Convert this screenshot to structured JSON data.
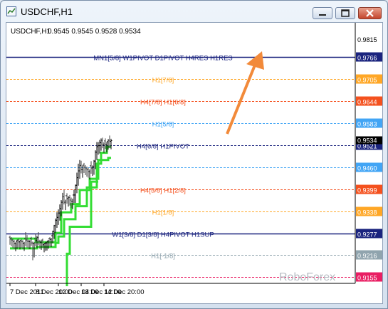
{
  "window": {
    "title": "USDCHF,H1"
  },
  "chart_header": {
    "symbol": "USDCHF,H1",
    "ohlc": "0.9545 0.9545 0.9528 0.9534"
  },
  "watermark": "RoboForex",
  "chart_data": {
    "type": "line",
    "title": "USDCHF,H1",
    "ylim": [
      0.913,
      0.9845
    ],
    "y_ticks": [
      "0.9815",
      "0.9155"
    ],
    "x_tick_labels": [
      "7 Dec 2011",
      "8 Dec 20:00",
      "12 Dec 04:00",
      "13 Dec 12:00",
      "14 Dec 20:00"
    ],
    "x_ticks": [
      {
        "label": "7 Dec 2011",
        "x": 0
      },
      {
        "label": "8 Dec 20:00",
        "x": 36
      },
      {
        "label": "12 Dec 04:00",
        "x": 68
      },
      {
        "label": "13 Dec 12:00",
        "x": 100
      },
      {
        "label": "14 Dec 20:00",
        "x": 132
      }
    ],
    "levels": [
      {
        "label": "MN1[5/8] W1PIVOT D1PIVOT H4RES H1RES",
        "value": 0.9766,
        "value_label": "0.9766",
        "color": "#1a237e",
        "style": "solid"
      },
      {
        "label": "H1[7/8]",
        "value": 0.9705,
        "value_label": "0.9705",
        "color": "#ffa726",
        "style": "dashed"
      },
      {
        "label": "H4[7/8] H1[6/8]",
        "value": 0.9644,
        "value_label": "0.9644",
        "color": "#f4511e",
        "style": "dashed"
      },
      {
        "label": "H1[5/8]",
        "value": 0.9583,
        "value_label": "0.9583",
        "color": "#42a5f5",
        "style": "dashed"
      },
      {
        "label": "H4[6/8] H1PIVOT",
        "value": 0.9521,
        "value_label": "0.9521",
        "color": "#1a237e",
        "style": "dashed"
      },
      {
        "label": "",
        "value": 0.946,
        "value_label": "0.9460",
        "color": "#42a5f5",
        "style": "dashed"
      },
      {
        "label": "H4[5/8] H1[2/8]",
        "value": 0.9399,
        "value_label": "0.9399",
        "color": "#f4511e",
        "style": "dashed"
      },
      {
        "label": "H1[1/8]",
        "value": 0.9338,
        "value_label": "0.9338",
        "color": "#ffa726",
        "style": "dashed"
      },
      {
        "label": "W1[3/8] D1[3/8] H4PIVOT H1SUP",
        "value": 0.9277,
        "value_label": "0.9277",
        "color": "#1a237e",
        "style": "solid"
      },
      {
        "label": "H1[-1/8]",
        "value": 0.9216,
        "value_label": "0.9216",
        "color": "#90a4ae",
        "style": "dashed"
      },
      {
        "label": "",
        "value": 0.9155,
        "value_label": "0.9155",
        "color": "#e91e63",
        "style": "dashed"
      }
    ],
    "current_price": {
      "value": 0.9534,
      "label": "0.9534"
    },
    "price": {
      "x": [
        0,
        2,
        4,
        6,
        8,
        10,
        12,
        14,
        16,
        18,
        20,
        22,
        24,
        26,
        28,
        30,
        32,
        34,
        36,
        38,
        40,
        42,
        44,
        46,
        48,
        50,
        52,
        54,
        56,
        58,
        60,
        62,
        64,
        66,
        68,
        70,
        72,
        74,
        76,
        78,
        80,
        82,
        84,
        86,
        88,
        90,
        92,
        94,
        96,
        98,
        100,
        102,
        104,
        106,
        108,
        110,
        112,
        114,
        116,
        118,
        120,
        122,
        124,
        126,
        128,
        130,
        132,
        134,
        136,
        138,
        140,
        142
      ],
      "open": [
        0.9266,
        0.9262,
        0.9258,
        0.9254,
        0.9248,
        0.9255,
        0.9258,
        0.9253,
        0.9257,
        0.9254,
        0.9249,
        0.9262,
        0.9258,
        0.9255,
        0.9254,
        0.9263,
        0.925,
        0.9248,
        0.9262,
        0.9257,
        0.9265,
        0.9255,
        0.9252,
        0.9258,
        0.9245,
        0.9249,
        0.925,
        0.9255,
        0.9262,
        0.926,
        0.927,
        0.9282,
        0.9298,
        0.9313,
        0.9321,
        0.9333,
        0.9345,
        0.9363,
        0.9378,
        0.9363,
        0.9381,
        0.9373,
        0.9376,
        0.9369,
        0.9366,
        0.9383,
        0.9383,
        0.941,
        0.9431,
        0.945,
        0.9465,
        0.9453,
        0.9466,
        0.946,
        0.9456,
        0.9453,
        0.9448,
        0.9464,
        0.9458,
        0.9461,
        0.9477,
        0.9502,
        0.9517,
        0.952,
        0.9528,
        0.9535,
        0.9522,
        0.9533,
        0.9523,
        0.9531,
        0.9535,
        0.9532
      ],
      "high": [
        0.927,
        0.9266,
        0.9262,
        0.9258,
        0.9252,
        0.9259,
        0.9262,
        0.9257,
        0.9261,
        0.9258,
        0.9253,
        0.928,
        0.9272,
        0.9259,
        0.9258,
        0.9267,
        0.9254,
        0.9252,
        0.9276,
        0.927,
        0.928,
        0.9259,
        0.9256,
        0.9262,
        0.9249,
        0.9253,
        0.9254,
        0.9259,
        0.9266,
        0.9264,
        0.9284,
        0.93,
        0.9318,
        0.9335,
        0.9343,
        0.9357,
        0.9369,
        0.9389,
        0.9397,
        0.937,
        0.9388,
        0.938,
        0.9383,
        0.9376,
        0.9373,
        0.9398,
        0.9412,
        0.9445,
        0.947,
        0.948,
        0.9478,
        0.9465,
        0.9472,
        0.9466,
        0.9462,
        0.9459,
        0.9454,
        0.9477,
        0.9465,
        0.948,
        0.9507,
        0.953,
        0.953,
        0.9536,
        0.954,
        0.9542,
        0.9529,
        0.954,
        0.953,
        0.9538,
        0.9548,
        0.9539
      ],
      "low": [
        0.9245,
        0.9241,
        0.9237,
        0.9233,
        0.9227,
        0.9234,
        0.9237,
        0.9232,
        0.9236,
        0.9233,
        0.9228,
        0.9241,
        0.9237,
        0.9234,
        0.9233,
        0.9242,
        0.9202,
        0.921,
        0.9241,
        0.9236,
        0.9244,
        0.9234,
        0.9231,
        0.9237,
        0.9224,
        0.9228,
        0.9229,
        0.9234,
        0.9241,
        0.9239,
        0.9249,
        0.9261,
        0.9277,
        0.9292,
        0.93,
        0.9312,
        0.9324,
        0.9342,
        0.9357,
        0.9341,
        0.9359,
        0.9351,
        0.9354,
        0.9347,
        0.9344,
        0.9361,
        0.9361,
        0.9388,
        0.9409,
        0.9428,
        0.9443,
        0.9431,
        0.9444,
        0.9438,
        0.9434,
        0.9431,
        0.9426,
        0.9442,
        0.9436,
        0.9439,
        0.9455,
        0.948,
        0.9495,
        0.9498,
        0.9506,
        0.9513,
        0.95,
        0.9511,
        0.9501,
        0.9509,
        0.9513,
        0.951
      ],
      "close": [
        0.9262,
        0.9258,
        0.9254,
        0.9248,
        0.9255,
        0.9258,
        0.9253,
        0.9257,
        0.9254,
        0.9249,
        0.9262,
        0.9258,
        0.9255,
        0.9254,
        0.9263,
        0.925,
        0.9248,
        0.9262,
        0.9257,
        0.9265,
        0.9255,
        0.9252,
        0.9258,
        0.9245,
        0.9249,
        0.925,
        0.9255,
        0.9262,
        0.926,
        0.927,
        0.9282,
        0.9298,
        0.9313,
        0.9321,
        0.9333,
        0.9345,
        0.9363,
        0.9378,
        0.9363,
        0.9381,
        0.9373,
        0.9376,
        0.9369,
        0.9366,
        0.9383,
        0.9383,
        0.941,
        0.9431,
        0.945,
        0.9465,
        0.9453,
        0.9466,
        0.946,
        0.9456,
        0.9453,
        0.9448,
        0.9464,
        0.9458,
        0.9461,
        0.9477,
        0.9502,
        0.9517,
        0.952,
        0.9528,
        0.9535,
        0.9522,
        0.9533,
        0.9523,
        0.9531,
        0.9535,
        0.9532,
        0.9534
      ]
    },
    "indicator_lines": [
      {
        "name": "",
        "color": "#33dd33",
        "points": [
          [
            0,
            0.9235
          ],
          [
            38,
            0.9235
          ],
          [
            38,
            0.9239
          ],
          [
            64,
            0.9239
          ],
          [
            64,
            0.925
          ],
          [
            68,
            0.925
          ],
          [
            68,
            0.9268
          ],
          [
            76,
            0.9268
          ],
          [
            76,
            0.9316
          ],
          [
            92,
            0.9316
          ],
          [
            92,
            0.9352
          ],
          [
            108,
            0.9352
          ],
          [
            108,
            0.9404
          ],
          [
            122,
            0.9404
          ],
          [
            122,
            0.947
          ],
          [
            128,
            0.947
          ],
          [
            128,
            0.95
          ],
          [
            136,
            0.95
          ],
          [
            136,
            0.9517
          ],
          [
            142,
            0.9517
          ]
        ]
      },
      {
        "name": "",
        "color": "#33dd33",
        "points": [
          [
            0,
            0.9262
          ],
          [
            36,
            0.9262
          ],
          [
            36,
            0.9252
          ],
          [
            64,
            0.9252
          ],
          [
            64,
            0.9278
          ],
          [
            72,
            0.9278
          ],
          [
            72,
            0.9335
          ],
          [
            86,
            0.9335
          ],
          [
            86,
            0.9358
          ],
          [
            98,
            0.9358
          ],
          [
            98,
            0.9397
          ],
          [
            112,
            0.9397
          ],
          [
            112,
            0.9428
          ],
          [
            124,
            0.9428
          ],
          [
            124,
            0.948
          ],
          [
            138,
            0.948
          ],
          [
            138,
            0.9486
          ],
          [
            142,
            0.9486
          ]
        ]
      },
      {
        "name": "",
        "color": "#33dd33",
        "points": [
          [
            80,
            0.913
          ],
          [
            80,
            0.922
          ],
          [
            84,
            0.922
          ],
          [
            84,
            0.9295
          ],
          [
            114,
            0.9295
          ],
          [
            114,
            0.942
          ],
          [
            124,
            0.942
          ]
        ]
      }
    ],
    "grid": false
  }
}
